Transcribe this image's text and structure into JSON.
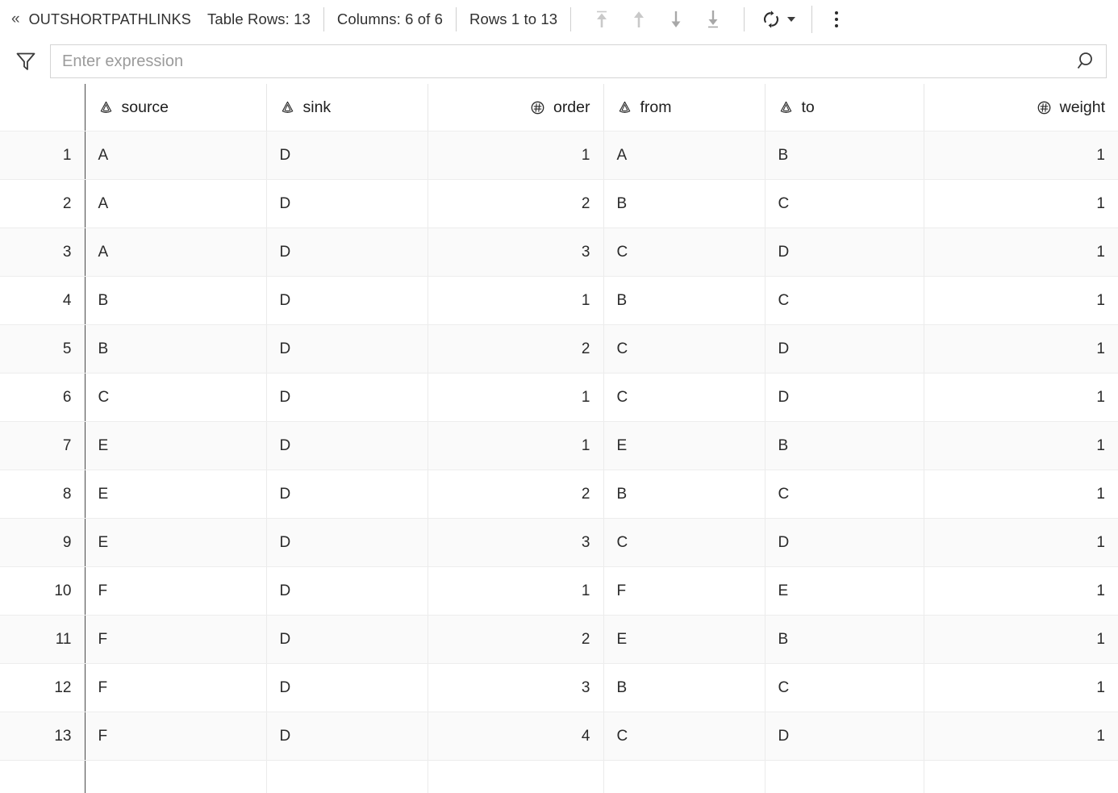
{
  "toolbar": {
    "collapse_icon": "double-chevron-left-icon",
    "title": "OUTSHORTPATHLINKS",
    "table_rows_label": "Table Rows: 13",
    "columns_label": "Columns: 6 of 6",
    "rows_range_label": "Rows 1 to 13",
    "nav": [
      {
        "name": "first-page-button",
        "icon": "arrow-up-to-line-icon",
        "enabled": false
      },
      {
        "name": "previous-page-button",
        "icon": "arrow-up-icon",
        "enabled": false
      },
      {
        "name": "next-page-button",
        "icon": "arrow-down-icon",
        "enabled": true
      },
      {
        "name": "last-page-button",
        "icon": "arrow-down-to-line-icon",
        "enabled": true
      }
    ],
    "refresh_icon": "refresh-sync-icon",
    "refresh_caret_icon": "chevron-down-icon",
    "more_options_icon": "kebab-menu-icon"
  },
  "filter": {
    "funnel_icon": "funnel-filter-icon",
    "placeholder": "Enter expression",
    "value": "",
    "search_icon": "search-icon"
  },
  "grid": {
    "rownum_header": "",
    "columns": [
      {
        "key": "source",
        "label": "source",
        "type": "string",
        "icon": "string-type-icon",
        "align": "left"
      },
      {
        "key": "sink",
        "label": "sink",
        "type": "string",
        "icon": "string-type-icon",
        "align": "left"
      },
      {
        "key": "order",
        "label": "order",
        "type": "number",
        "icon": "number-type-icon",
        "align": "right"
      },
      {
        "key": "from",
        "label": "from",
        "type": "string",
        "icon": "string-type-icon",
        "align": "left"
      },
      {
        "key": "to",
        "label": "to",
        "type": "string",
        "icon": "string-type-icon",
        "align": "left"
      },
      {
        "key": "weight",
        "label": "weight",
        "type": "number",
        "icon": "number-type-icon",
        "align": "right"
      }
    ],
    "rows": [
      {
        "n": "1",
        "source": "A",
        "sink": "D",
        "order": "1",
        "from": "A",
        "to": "B",
        "weight": "1"
      },
      {
        "n": "2",
        "source": "A",
        "sink": "D",
        "order": "2",
        "from": "B",
        "to": "C",
        "weight": "1"
      },
      {
        "n": "3",
        "source": "A",
        "sink": "D",
        "order": "3",
        "from": "C",
        "to": "D",
        "weight": "1"
      },
      {
        "n": "4",
        "source": "B",
        "sink": "D",
        "order": "1",
        "from": "B",
        "to": "C",
        "weight": "1"
      },
      {
        "n": "5",
        "source": "B",
        "sink": "D",
        "order": "2",
        "from": "C",
        "to": "D",
        "weight": "1"
      },
      {
        "n": "6",
        "source": "C",
        "sink": "D",
        "order": "1",
        "from": "C",
        "to": "D",
        "weight": "1"
      },
      {
        "n": "7",
        "source": "E",
        "sink": "D",
        "order": "1",
        "from": "E",
        "to": "B",
        "weight": "1"
      },
      {
        "n": "8",
        "source": "E",
        "sink": "D",
        "order": "2",
        "from": "B",
        "to": "C",
        "weight": "1"
      },
      {
        "n": "9",
        "source": "E",
        "sink": "D",
        "order": "3",
        "from": "C",
        "to": "D",
        "weight": "1"
      },
      {
        "n": "10",
        "source": "F",
        "sink": "D",
        "order": "1",
        "from": "F",
        "to": "E",
        "weight": "1"
      },
      {
        "n": "11",
        "source": "F",
        "sink": "D",
        "order": "2",
        "from": "E",
        "to": "B",
        "weight": "1"
      },
      {
        "n": "12",
        "source": "F",
        "sink": "D",
        "order": "3",
        "from": "B",
        "to": "C",
        "weight": "1"
      },
      {
        "n": "13",
        "source": "F",
        "sink": "D",
        "order": "4",
        "from": "C",
        "to": "D",
        "weight": "1"
      }
    ]
  },
  "colors": {
    "text": "#2a2a2a",
    "muted": "#6d6d6d",
    "border": "#ebebeb",
    "row_alt": "#fafafa",
    "divider_strong": "#4a4a4a",
    "icon_disabled": "#c9c9c9",
    "icon_enabled": "#9a9a9a"
  }
}
